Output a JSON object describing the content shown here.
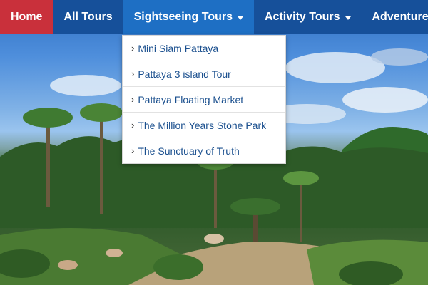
{
  "nav": {
    "items": [
      {
        "label": "Home"
      },
      {
        "label": "All Tours"
      },
      {
        "label": "Sightseeing Tours"
      },
      {
        "label": "Activity Tours"
      },
      {
        "label": "Adventure T"
      }
    ]
  },
  "dropdown": {
    "items": [
      {
        "label": "Mini Siam Pattaya"
      },
      {
        "label": "Pattaya 3 island Tour"
      },
      {
        "label": "Pattaya Floating Market"
      },
      {
        "label": "The Million Years Stone Park"
      },
      {
        "label": "The Sunctuary of Truth"
      }
    ]
  },
  "colors": {
    "navbar": "#16509a",
    "home": "#c9303b",
    "active": "#1e6fc4",
    "dropdown_text": "#1a4f8e"
  }
}
